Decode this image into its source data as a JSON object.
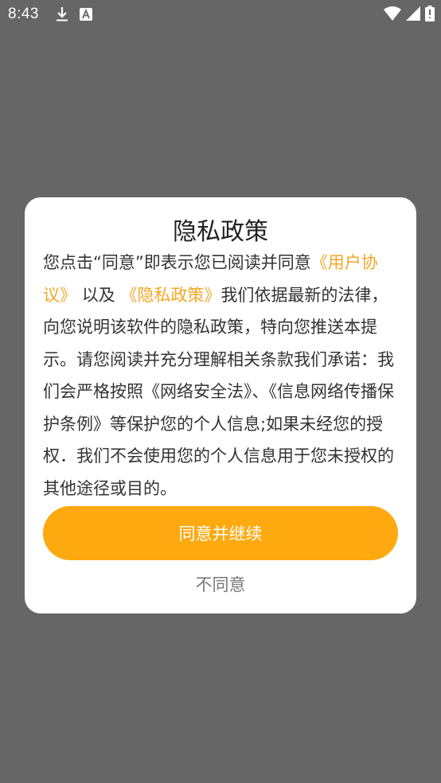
{
  "status_bar": {
    "time": "8:43",
    "icons": [
      "download-icon",
      "font-a-icon",
      "wifi-icon",
      "signal-icon",
      "battery-icon"
    ]
  },
  "dialog": {
    "title": "隐私政策",
    "body": {
      "prefix": "您点击“同意”即表示您已阅读并同意",
      "user_agreement_link": "《用户协议》",
      "and_text": "以及",
      "privacy_policy_link": "《隐私政策》",
      "suffix": "我们依据最新的法律，向您说明该软件的隐私政策，特向您推送本提示。请您阅读并充分理解相关条款我们承诺：我们会严格按照《网络安全法》、《信息网络传播保护条例》等保护您的个人信息;如果未经您的授权．我们不会使用您的个人信息用于您未授权的其他途径或目的。"
    },
    "agree_button": "同意并继续",
    "decline_button": "不同意"
  },
  "colors": {
    "accent": "#FDA90F",
    "link": "#F5A623",
    "backdrop": "#666666"
  }
}
